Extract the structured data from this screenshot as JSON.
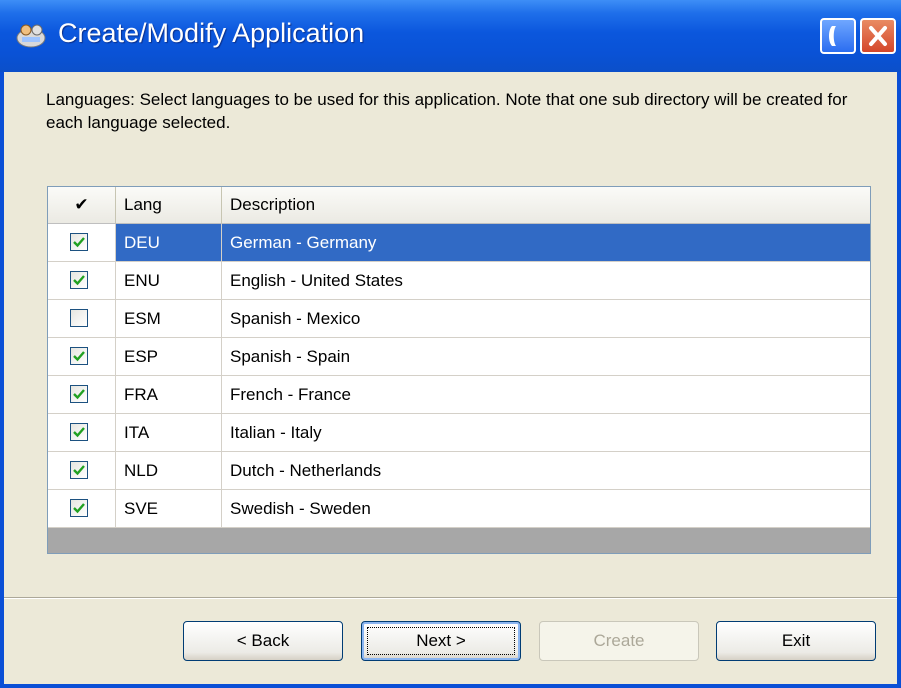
{
  "window": {
    "title": "Create/Modify Application"
  },
  "instructions": "Languages: Select languages to be used for this application.  Note that one sub directory will be created for each language selected.",
  "grid": {
    "columns": {
      "check": "✔",
      "lang": "Lang",
      "description": "Description"
    },
    "rows": [
      {
        "lang": "DEU",
        "description": "German - Germany",
        "checked": true,
        "selected": true
      },
      {
        "lang": "ENU",
        "description": "English - United States",
        "checked": true,
        "selected": false
      },
      {
        "lang": "ESM",
        "description": "Spanish - Mexico",
        "checked": false,
        "selected": false
      },
      {
        "lang": "ESP",
        "description": "Spanish - Spain",
        "checked": true,
        "selected": false
      },
      {
        "lang": "FRA",
        "description": "French - France",
        "checked": true,
        "selected": false
      },
      {
        "lang": "ITA",
        "description": "Italian - Italy",
        "checked": true,
        "selected": false
      },
      {
        "lang": "NLD",
        "description": "Dutch - Netherlands",
        "checked": true,
        "selected": false
      },
      {
        "lang": "SVE",
        "description": "Swedish - Sweden",
        "checked": true,
        "selected": false
      }
    ]
  },
  "buttons": {
    "back": "< Back",
    "next": "Next >",
    "create": "Create",
    "exit": "Exit"
  },
  "colors": {
    "titlebar": "#0a52d6",
    "selection": "#316ac5",
    "face": "#ece9d8"
  },
  "icons": {
    "app": "app-logo-icon",
    "minimize": "minimize-icon",
    "close": "close-icon",
    "checkmark": "checkmark-icon"
  }
}
